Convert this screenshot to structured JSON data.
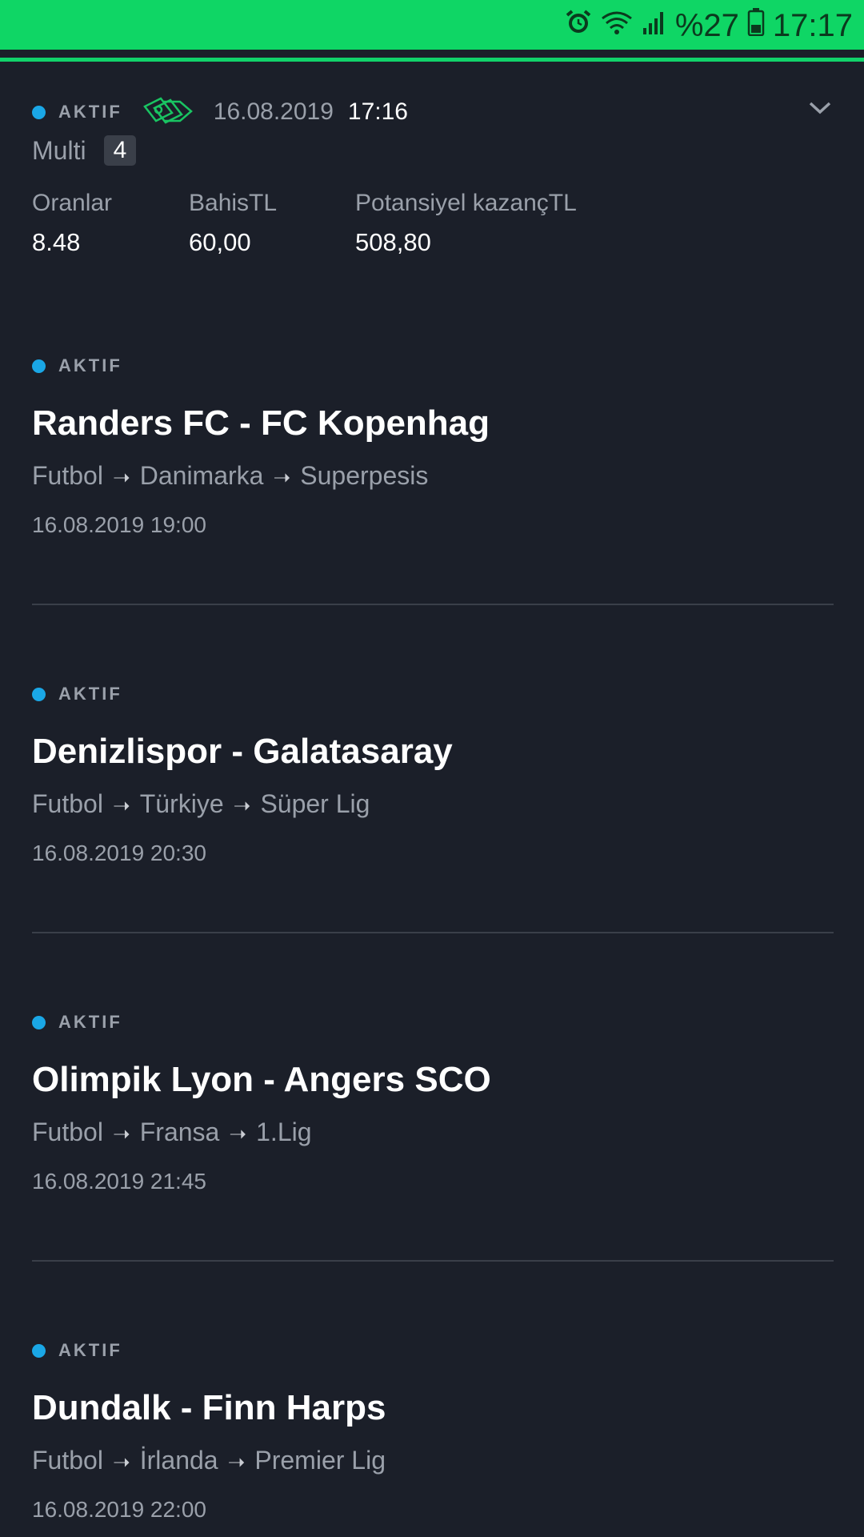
{
  "status_bar": {
    "battery_percent": "%27",
    "time": "17:17",
    "icons": [
      "alarm-icon",
      "wifi-icon",
      "signal-icon",
      "battery-icon"
    ]
  },
  "summary": {
    "status": "AKTIF",
    "date": "16.08.2019",
    "time": "17:16",
    "type_label": "Multi",
    "count": "4",
    "odds_label": "Oranlar",
    "odds_value": "8.48",
    "stake_label": "BahisTL",
    "stake_value": "60,00",
    "payout_label": "Potansiyel kazançTL",
    "payout_value": "508,80"
  },
  "matches": [
    {
      "status": "AKTIF",
      "title": "Randers FC - FC Kopenhag",
      "sport": "Futbol",
      "country": "Danimarka",
      "league": "Superpesis",
      "datetime": "16.08.2019 19:00"
    },
    {
      "status": "AKTIF",
      "title": "Denizlispor - Galatasaray",
      "sport": "Futbol",
      "country": "Türkiye",
      "league": "Süper Lig",
      "datetime": "16.08.2019 20:30"
    },
    {
      "status": "AKTIF",
      "title": "Olimpik Lyon - Angers SCO",
      "sport": "Futbol",
      "country": "Fransa",
      "league": "1.Lig",
      "datetime": "16.08.2019 21:45"
    },
    {
      "status": "AKTIF",
      "title": "Dundalk - Finn Harps",
      "sport": "Futbol",
      "country": "İrlanda",
      "league": "Premier Lig",
      "datetime": "16.08.2019 22:00"
    }
  ],
  "colors": {
    "accent_green": "#0fd665",
    "background": "#1b1f29",
    "status_dot": "#1aa7e6"
  }
}
